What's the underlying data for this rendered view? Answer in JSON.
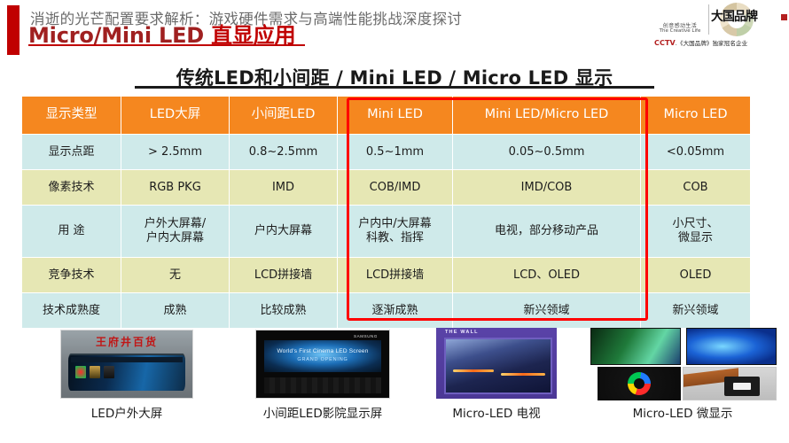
{
  "overlay": {
    "title": "消逝的光芒配置要求解析：游戏硬件需求与高端性能挑战深度探讨"
  },
  "slide": {
    "heading_en": "Micro/Mini LED ",
    "heading_cn": "直显应用",
    "table_title": "传统LED和小间距 / Mini LED / Micro LED 显示"
  },
  "brand": {
    "tagline_cn": "创意感动生活",
    "tagline_en": "The Creative Life",
    "name_cn": "大国品牌",
    "footer_prefix": "CCTV",
    "footer_text": ".《大国品牌》独家冠名企业"
  },
  "colors": {
    "header_orange": "#f5871f",
    "row_blue": "#cfeaea",
    "row_yellow": "#e6e7b4",
    "highlight_red": "#ff0000",
    "heading_red": "#c00000"
  },
  "table": {
    "headers": [
      "显示类型",
      "LED大屏",
      "小间距LED",
      "Mini LED",
      "Mini LED/Micro LED",
      "Micro LED"
    ],
    "rows": [
      {
        "label": "显示点距",
        "tone": "blue",
        "height": "reg",
        "cells": [
          "> 2.5mm",
          "0.8~2.5mm",
          "0.5~1mm",
          "0.05~0.5mm",
          "<0.05mm"
        ]
      },
      {
        "label": "像素技术",
        "tone": "yellow",
        "height": "reg",
        "cells": [
          "RGB PKG",
          "IMD",
          "COB/IMD",
          "IMD/COB",
          "COB"
        ]
      },
      {
        "label": "用 途",
        "tone": "blue",
        "height": "tall",
        "cells": [
          "户外大屏幕/\n户内大屏幕",
          "户内大屏幕",
          "户内中/大屏幕\n科教、指挥",
          "电视，部分移动产品",
          "小尺寸、\n微显示"
        ]
      },
      {
        "label": "竞争技术",
        "tone": "yellow",
        "height": "reg",
        "cells": [
          "无",
          "LCD拼接墙",
          "LCD拼接墙",
          "LCD、OLED",
          "OLED"
        ]
      },
      {
        "label": "技术成熟度",
        "tone": "blue",
        "height": "reg",
        "cells": [
          "成熟",
          "比较成熟",
          "逐渐成熟",
          "新兴领域",
          "新兴领域"
        ]
      }
    ],
    "highlight_columns": [
      "Mini LED",
      "Mini LED/Micro LED"
    ]
  },
  "thumbnails": [
    {
      "caption": "LED户外大屏",
      "sign_text": "王府井百货"
    },
    {
      "caption": "小间距LED影院显示屏",
      "screen_line1": "World's First Cinema LED Screen",
      "screen_line2": "GRAND OPENING",
      "brand_mark": "SAMSUNG"
    },
    {
      "caption": "Micro-LED 电视",
      "badge": "THE WALL"
    },
    {
      "caption": "Micro-LED 微显示"
    }
  ]
}
